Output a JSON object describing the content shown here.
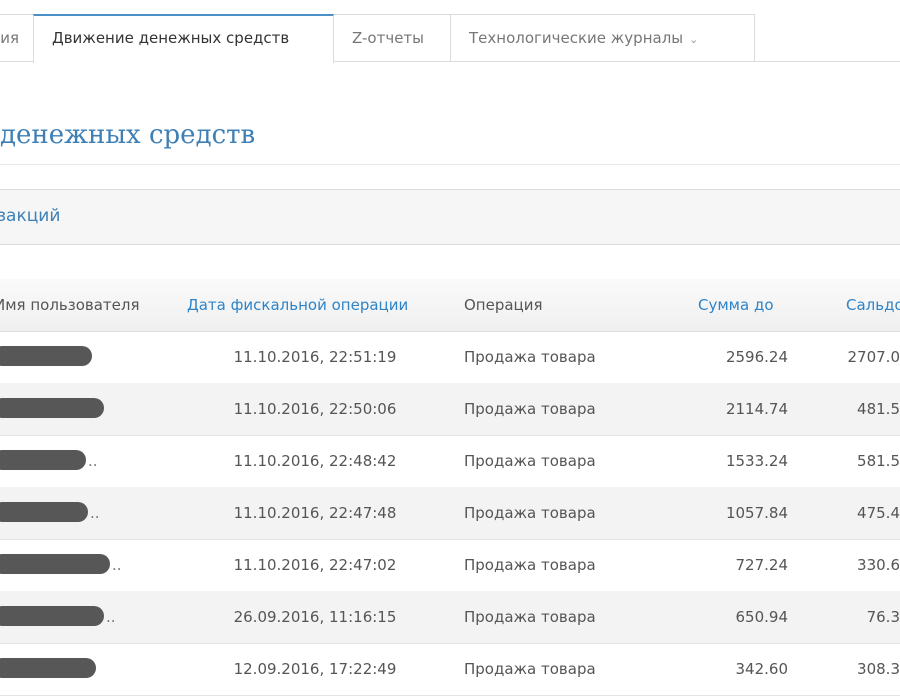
{
  "tabs": [
    {
      "label": "ия",
      "active": false
    },
    {
      "label": "Движение денежных средств",
      "active": true
    },
    {
      "label": "Z-отчеты",
      "active": false
    },
    {
      "label": "Технологические журналы",
      "active": false,
      "dropdown": true
    }
  ],
  "page_title": "денежных средств",
  "panel_title": "закций",
  "table": {
    "columns": [
      {
        "label": "Имя пользователя",
        "sortable": false
      },
      {
        "label": "Дата фискальной операции",
        "sortable": true
      },
      {
        "label": "Операция",
        "sortable": false
      },
      {
        "label": "Сумма до",
        "sortable": true
      },
      {
        "label": "Сальдо",
        "sortable": true
      }
    ],
    "rows": [
      {
        "user": "",
        "user_suffix": "",
        "date": "11.10.2016, 22:51:19",
        "operation": "Продажа товара",
        "sum_before": "2596.24",
        "balance": "2707.0"
      },
      {
        "user": "",
        "user_suffix": "",
        "date": "11.10.2016, 22:50:06",
        "operation": "Продажа товара",
        "sum_before": "2114.74",
        "balance": "481.5"
      },
      {
        "user": "",
        "user_suffix": "..",
        "date": "11.10.2016, 22:48:42",
        "operation": "Продажа товара",
        "sum_before": "1533.24",
        "balance": "581.5"
      },
      {
        "user": "",
        "user_suffix": "..",
        "date": "11.10.2016, 22:47:48",
        "operation": "Продажа товара",
        "sum_before": "1057.84",
        "balance": "475.4"
      },
      {
        "user": "",
        "user_suffix": "..",
        "date": "11.10.2016, 22:47:02",
        "operation": "Продажа товара",
        "sum_before": "727.24",
        "balance": "330.6"
      },
      {
        "user": "",
        "user_suffix": "..",
        "date": "26.09.2016, 11:16:15",
        "operation": "Продажа товара",
        "sum_before": "650.94",
        "balance": "76.3"
      },
      {
        "user": "",
        "user_suffix": "",
        "date": "12.09.2016, 17:22:49",
        "operation": "Продажа товара",
        "sum_before": "342.60",
        "balance": "308.3"
      }
    ]
  },
  "colors": {
    "accent": "#2f84c8",
    "title": "#3e7fb5",
    "active_tab_border": "#4a8fc7",
    "redaction": "#575757"
  }
}
